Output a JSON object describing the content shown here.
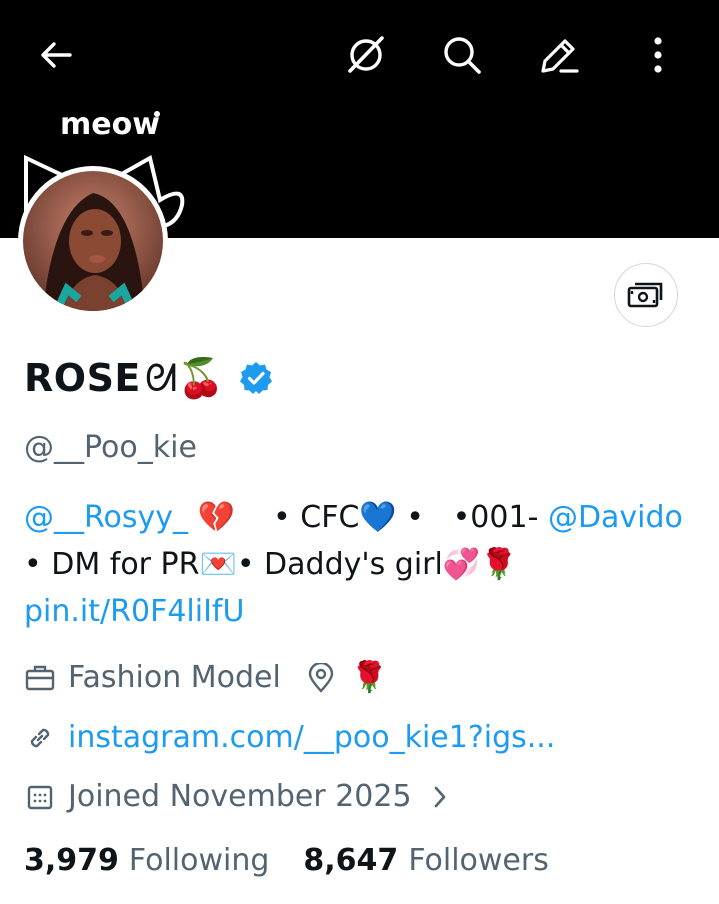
{
  "banner": {
    "doodle_text": "meow"
  },
  "topbar": {
    "back_icon": "arrow-left-icon",
    "grok_icon": "grok-icon",
    "search_icon": "search-icon",
    "edit_icon": "edit-icon",
    "more_icon": "more-vertical-icon"
  },
  "profile": {
    "display_name": "ROSE",
    "name_emoji": "ᘛ🍒",
    "verified": true,
    "handle": "@__Poo_kie",
    "tip_icon": "money-icon"
  },
  "bio": {
    "mention_1": "@__Rosyy_",
    "emoji_1": " 💔",
    "text_1": "    • CFC💙 •   •001- ",
    "mention_2": "@Davido",
    "text_2": "• DM for PR💌•  Daddy's girl💞🌹 ",
    "link": "pin.it/R0F4liIfU"
  },
  "meta": {
    "profession": "Fashion Model",
    "location": "🌹",
    "website": "instagram.com/__poo_kie1?igs...",
    "joined": "Joined November 2025"
  },
  "stats": {
    "following_count": "3,979",
    "following_label": "Following",
    "followers_count": "8,647",
    "followers_label": "Followers"
  },
  "colors": {
    "accent": "#1d9bf0",
    "muted": "#536471",
    "text": "#0f1419",
    "banner": "#000000"
  }
}
